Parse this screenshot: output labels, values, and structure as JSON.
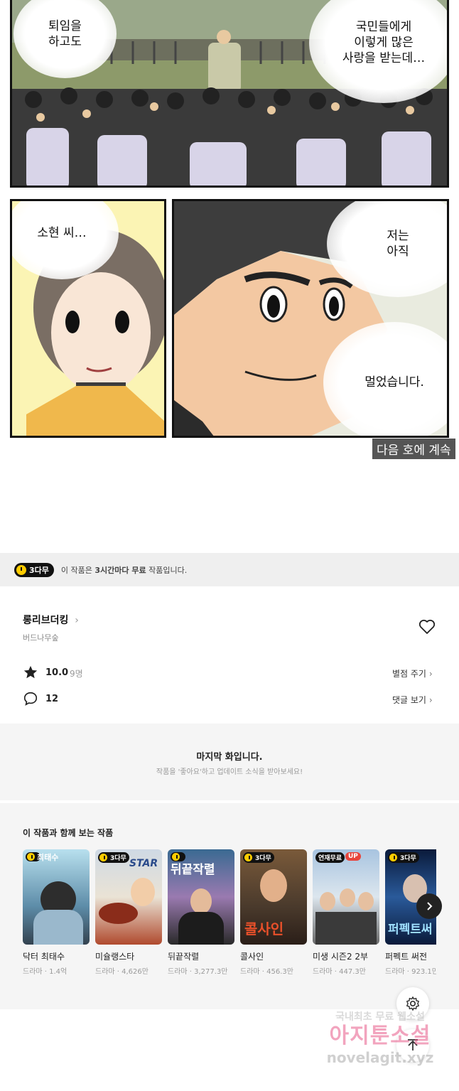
{
  "comic": {
    "bubble1": "퇴임을\n하고도",
    "bubble2": "국민들에게\n이렇게 많은\n사랑을 받는데…",
    "bubble3": "소현 씨…",
    "bubble4": "저는\n아직",
    "bubble5": "멀었습니다.",
    "caption": "다음 호에 계속"
  },
  "notice": {
    "badge": "3다무",
    "text_prefix": "이 작품은 ",
    "text_bold": "3시간마다 무료",
    "text_suffix": " 작품입니다."
  },
  "work": {
    "title": "롱리브더킹",
    "author": "버드나무숲",
    "rating": "10.0",
    "rating_count": "9명",
    "rate_link": "별점 주기",
    "comments": "12",
    "comments_link": "댓글 보기"
  },
  "last_episode": {
    "title": "마지막 화입니다.",
    "subtitle": "작품을 '좋아요'하고 업데이트 소식을 받아보세요!"
  },
  "recommend": {
    "heading": "이 작품과 함께 보는 작품",
    "items": [
      {
        "title": "닥터 최태수",
        "meta": "드라마 · 1.4억",
        "badge": "",
        "cover_text": "최태수"
      },
      {
        "title": "미슐랭스타",
        "meta": "드라마 · 4,626만",
        "badge": "3다무",
        "cover_text": "STAR"
      },
      {
        "title": "뒤끝작렬",
        "meta": "드라마 · 3,277.3만",
        "badge": "",
        "cover_text": "뒤끝작렬"
      },
      {
        "title": "콜사인",
        "meta": "드라마 · 456.3만",
        "badge": "3다무",
        "cover_text": "콜사인"
      },
      {
        "title": "미생 시즌2 2부",
        "meta": "드라마 · 447.3만",
        "badge": "연재무료",
        "badge2": "UP",
        "cover_text": ""
      },
      {
        "title": "퍼펙트 써전",
        "meta": "드라마 · 923.1만",
        "badge": "3다무",
        "cover_text": "퍼펙트써"
      }
    ]
  },
  "watermark": {
    "line1": "국내최초 무료 웹소설",
    "line2": "아지툰소설",
    "line3": "novelagit.xyz"
  },
  "colors": {
    "badge_yellow": "#ffcc00",
    "up_red": "#e8453c",
    "grey_bg": "#f5f5f5"
  }
}
